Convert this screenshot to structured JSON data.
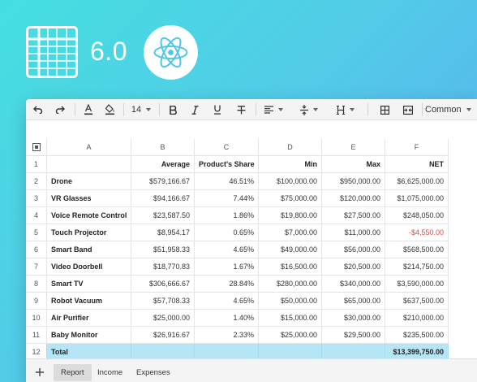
{
  "hero": {
    "version": "6.0"
  },
  "toolbar": {
    "font_size": "14",
    "format": "Common",
    "icons": [
      "undo-icon",
      "redo-icon",
      "text-color-icon",
      "fill-color-icon",
      "bold-icon",
      "italic-icon",
      "underline-icon",
      "strikethrough-icon",
      "align-left-icon",
      "vertical-align-icon",
      "text-height-icon",
      "borders-icon",
      "merge-cells-icon"
    ],
    "accent": "#e0e0e0"
  },
  "sheet": {
    "columns": [
      "A",
      "B",
      "C",
      "D",
      "E",
      "F"
    ],
    "row_numbers": [
      "1",
      "2",
      "3",
      "4",
      "5",
      "6",
      "7",
      "8",
      "9",
      "10",
      "11",
      "12"
    ],
    "header_row": [
      "",
      "Average",
      "Product's Share",
      "Min",
      "Max",
      "NET"
    ],
    "rows": [
      [
        "Drone",
        "$579,166.67",
        "46.51%",
        "$100,000.00",
        "$950,000.00",
        "$6,625,000.00"
      ],
      [
        "VR Glasses",
        "$94,166.67",
        "7.44%",
        "$75,000.00",
        "$120,000.00",
        "$1,075,000.00"
      ],
      [
        "Voice Remote Control",
        "$23,587.50",
        "1.86%",
        "$19,800.00",
        "$27,500.00",
        "$248,050.00"
      ],
      [
        "Touch Projector",
        "$8,954.17",
        "0.65%",
        "$7,000.00",
        "$11,000.00",
        "-$4,550.00"
      ],
      [
        "Smart Band",
        "$51,958.33",
        "4.65%",
        "$49,000.00",
        "$56,000.00",
        "$568,500.00"
      ],
      [
        "Video Doorbell",
        "$18,770.83",
        "1.67%",
        "$16,500.00",
        "$20,500.00",
        "$214,750.00"
      ],
      [
        "Smart TV",
        "$306,666.67",
        "28.84%",
        "$280,000.00",
        "$340,000.00",
        "$3,590,000.00"
      ],
      [
        "Robot Vacuum",
        "$57,708.33",
        "4.65%",
        "$50,000.00",
        "$65,000.00",
        "$637,500.00"
      ],
      [
        "Air Purifier",
        "$25,000.00",
        "1.40%",
        "$15,000.00",
        "$30,000.00",
        "$210,000.00"
      ],
      [
        "Baby Monitor",
        "$26,916.67",
        "2.33%",
        "$25,000.00",
        "$29,500.00",
        "$235,500.00"
      ]
    ],
    "total": [
      "Total",
      "",
      "",
      "",
      "",
      "$13,399,750.00"
    ],
    "negative_color": "#e54848",
    "total_fill": "#b6e6f5"
  },
  "tabs": [
    "Report",
    "Income",
    "Expenses"
  ]
}
